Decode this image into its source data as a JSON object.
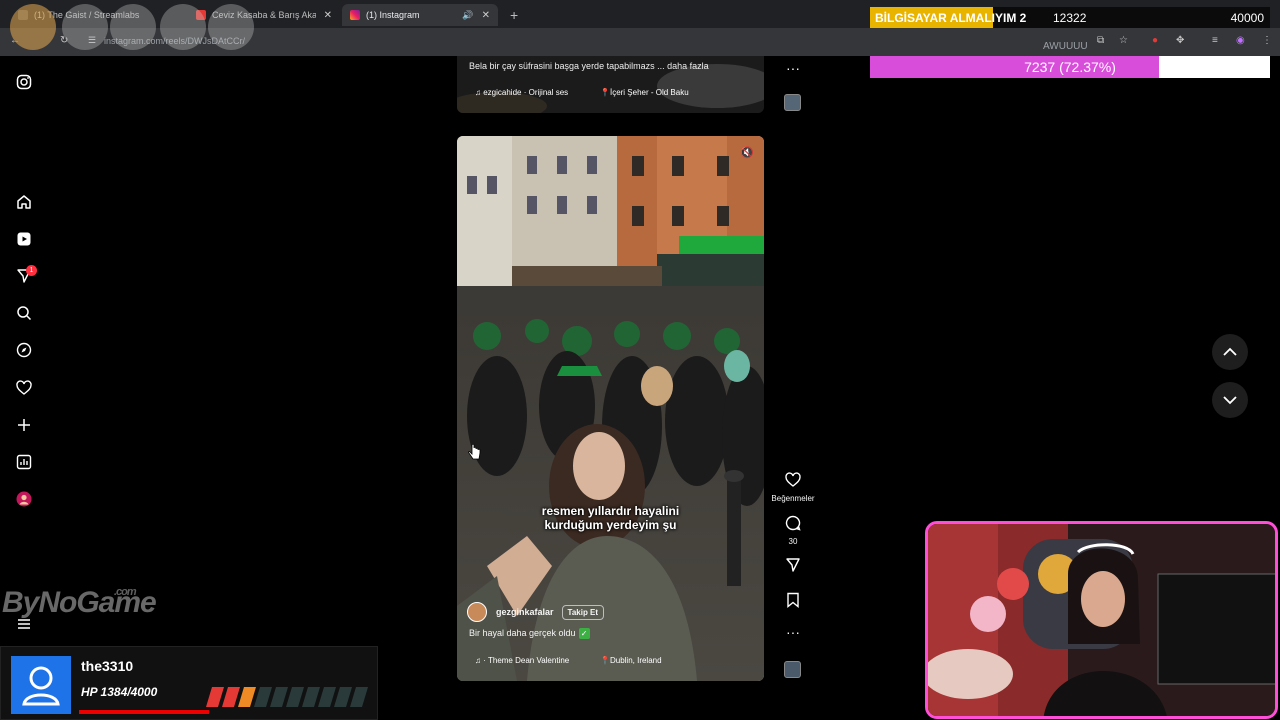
{
  "browser": {
    "tabs": [
      {
        "label": "(1) The Gaist / Streamlabs",
        "active": false
      },
      {
        "label": "Ceviz Kasaba & Barış Akarsu - Te",
        "active": false
      },
      {
        "label": "(1) Instagram",
        "active": true
      }
    ],
    "new_tab_label": "+",
    "url": "instagram.com/reels/DWJsDAtCCr/"
  },
  "overlay": {
    "goal_title": "BİLGİSAYAR ALMALIYIM 2",
    "goal_current": "12322",
    "goal_target": "40000",
    "goal_fraction": 0.308,
    "sub_text": "7237 (72.37%)",
    "sub_fraction": 0.7237,
    "awu_text": "AWUUUU",
    "accent_color": "#d94ddb",
    "goal_color": "#e9b400"
  },
  "sidebar": {
    "icons": [
      "instagram-logo-icon",
      "home-icon",
      "reels-icon",
      "messages-icon",
      "search-icon",
      "explore-icon",
      "heart-icon",
      "create-icon",
      "dashboard-icon",
      "profile-icon"
    ],
    "messages_badge": "1"
  },
  "prev_reel": {
    "caption": "Bela bir çay süfrasini başga yerde tapabilmazs ... daha fazla",
    "audio": "ezgicahide · Orijinal ses",
    "location": "İçeri Şeher - Old Baku"
  },
  "reel": {
    "subtitle_line1": "resmen yıllardır hayalini",
    "subtitle_line2": "kurduğum yerdeyim şu",
    "author": "gezginkafalar",
    "follow_label": "Takip Et",
    "caption": "Bir hayal daha gerçek oldu",
    "audio": "· Theme  Dean Valentine",
    "location": "Dublin, Ireland"
  },
  "actions": {
    "like_label": "Beğenmeler",
    "comments_count": "30"
  },
  "watermark": {
    "text": "ByNoGame",
    "suffix": ".com"
  },
  "hud": {
    "player_name": "the3310",
    "hp_text": "HP 1384/4000",
    "hp_fraction": 0.346
  }
}
